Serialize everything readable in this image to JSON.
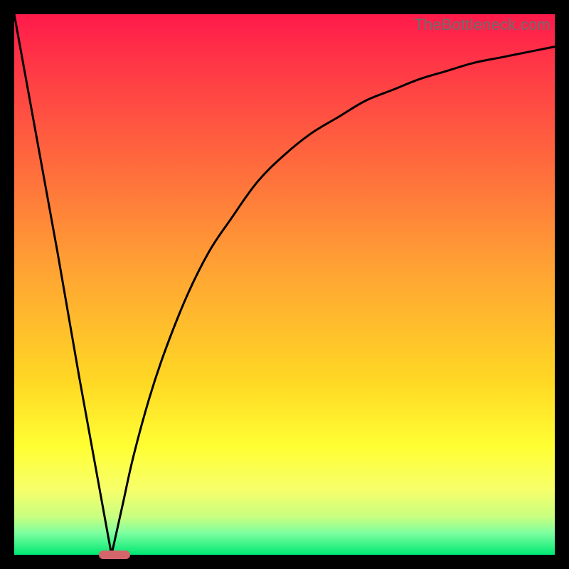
{
  "watermark_text": "TheBottleneck.com",
  "colors": {
    "frame_bg": "#000000",
    "curve_stroke": "#000000",
    "marker_fill": "#d4666b",
    "gradient_stops": [
      "#ff1a4b",
      "#ff3347",
      "#ff6b3d",
      "#ffa533",
      "#ffd824",
      "#ffff33",
      "#f7ff6b",
      "#c8ff80",
      "#7dffa0",
      "#00e873"
    ]
  },
  "chart_data": {
    "type": "line",
    "title": "",
    "xlabel": "",
    "ylabel": "",
    "xlim": [
      0,
      100
    ],
    "ylim": [
      0,
      100
    ],
    "grid": false,
    "series": [
      {
        "name": "left-segment",
        "x": [
          0,
          4,
          8,
          12,
          16,
          18
        ],
        "y": [
          100,
          78,
          56,
          33,
          11,
          0
        ]
      },
      {
        "name": "right-segment",
        "x": [
          18,
          20,
          22,
          25,
          28,
          32,
          36,
          40,
          45,
          50,
          55,
          60,
          65,
          70,
          75,
          80,
          85,
          90,
          95,
          100
        ],
        "y": [
          0,
          9,
          18,
          29,
          38,
          48,
          56,
          62,
          69,
          74,
          78,
          81,
          84,
          86,
          88,
          89.5,
          91,
          92,
          93,
          94
        ]
      }
    ],
    "annotations": [
      {
        "name": "min-marker",
        "shape": "pill",
        "x": 18.5,
        "y": 0,
        "color": "#d4666b"
      }
    ]
  }
}
